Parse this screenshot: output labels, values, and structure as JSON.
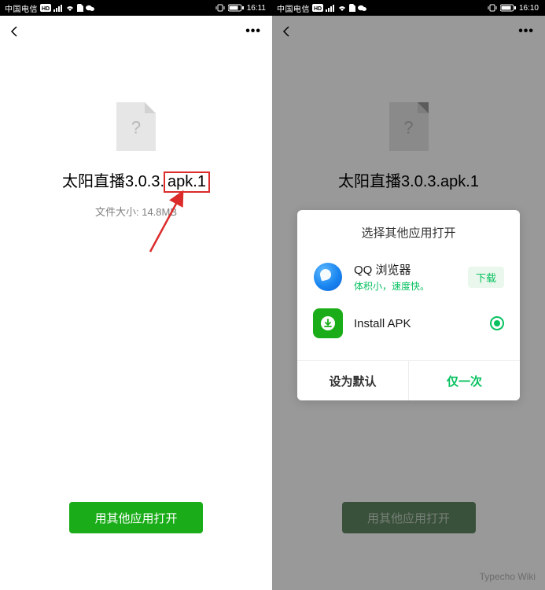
{
  "left": {
    "status": {
      "carrier": "中国电信",
      "time": "16:11"
    },
    "file": {
      "icon_mark": "?",
      "name_part1": "太阳直播3.0.3.",
      "name_part2_highlight": "apk.1",
      "size_label": "文件大小: 14.8MB"
    },
    "action_button": "用其他应用打开"
  },
  "right": {
    "status": {
      "carrier": "中国电信",
      "time": "16:10"
    },
    "file": {
      "icon_mark": "?",
      "name_full": "太阳直播3.0.3.apk.1"
    },
    "sheet": {
      "title": "选择其他应用打开",
      "items": [
        {
          "title": "QQ 浏览器",
          "subtitle": "体积小，速度快。",
          "trailing": "下载"
        },
        {
          "title": "Install APK",
          "selected": true
        }
      ],
      "footer": {
        "set_default": "设为默认",
        "once": "仅一次"
      }
    },
    "action_button": "用其他应用打开"
  },
  "watermark": "Typecho Wiki"
}
